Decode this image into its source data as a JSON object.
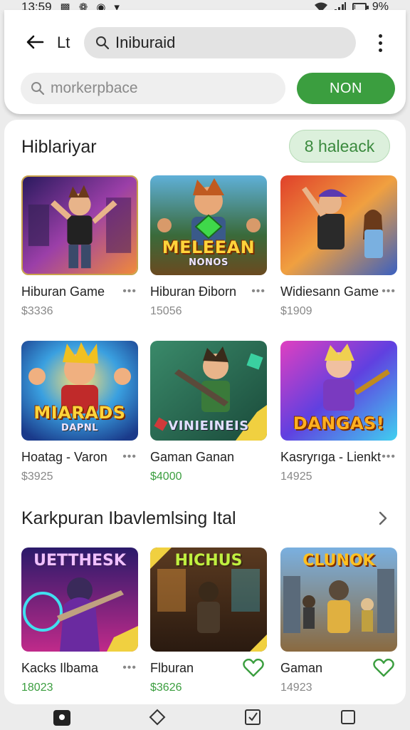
{
  "status": {
    "time": "13:59",
    "battery_text": "9%",
    "battery_level": 0.09
  },
  "header": {
    "title": "Lt",
    "search_value": "Iniburaid",
    "filter_placeholder": "morkerpbace",
    "action_label": "NON"
  },
  "section1": {
    "title": "Hiblariyar",
    "pill_label": "8 haleack",
    "cards": [
      {
        "name": "Hiburan Game",
        "price": "$3336",
        "price_green": false,
        "overlay": "",
        "icon": "more-icon"
      },
      {
        "name": "Hiburan Ðiborn",
        "price": "15056",
        "price_green": false,
        "overlay": "MELEEAN",
        "overlay_sub": "NONOS",
        "icon": "more-icon"
      },
      {
        "name": "Widiesann Game",
        "price": "$1909",
        "price_green": false,
        "overlay": "",
        "icon": "more-icon"
      },
      {
        "name": "Hoatag - Varon",
        "price": "$3925",
        "price_green": false,
        "overlay": "MIARADS",
        "overlay_sub": "DAPNL",
        "icon": "more-icon"
      },
      {
        "name": "Gaman Ganan",
        "price": "$4000",
        "price_green": true,
        "overlay": "VINIEINEIS",
        "overlay_sub": "",
        "icon": "none"
      },
      {
        "name": "Kasryrıga - Lienkt",
        "price": "14925",
        "price_green": false,
        "overlay": "DANGAS!",
        "overlay_sub": "",
        "icon": "more-icon"
      }
    ]
  },
  "section2": {
    "title": "Karkpuran Ibavlemlsing Ital",
    "cards": [
      {
        "name": "Kacks Ilbama",
        "price": "18023",
        "price_green": true,
        "overlay_top": "UETTHESK",
        "icon": "more-icon"
      },
      {
        "name": "Flburan",
        "price": "$3626",
        "price_green": true,
        "overlay_top": "HICHUS",
        "icon": "heart-icon"
      },
      {
        "name": "Gaman",
        "price": "14923",
        "price_green": false,
        "overlay_top": "CLUNOK",
        "icon": "heart-icon"
      }
    ]
  },
  "colors": {
    "accent": "#3b9e3f",
    "pill_bg": "#dcf0dc"
  }
}
